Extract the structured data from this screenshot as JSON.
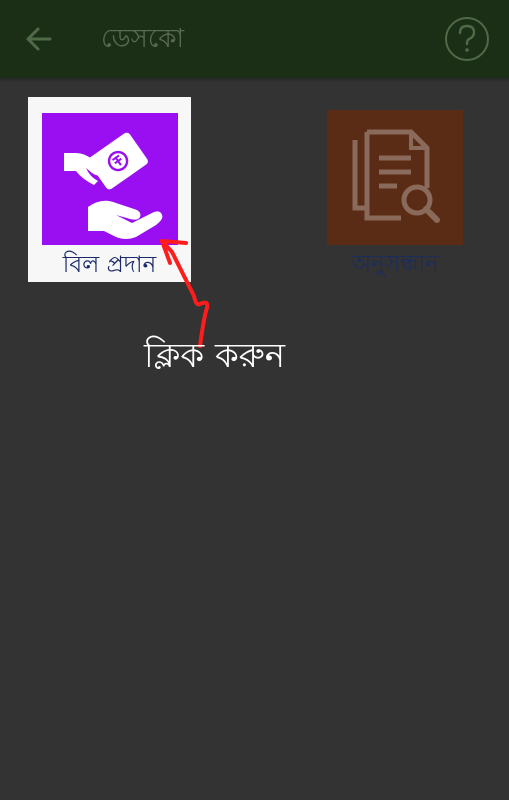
{
  "header": {
    "title": "ডেসকো",
    "back_icon": "arrow-left-icon",
    "help_icon": "question-circle-icon",
    "bar_color": "#1b2e16"
  },
  "menu": {
    "items": [
      {
        "id": "bill-payment",
        "label": "বিল প্রদান",
        "icon": "hand-paying-bill-icon",
        "icon_bg": "#9a0ef2"
      },
      {
        "id": "search",
        "label": "অনুসন্ধান",
        "icon": "document-search-icon",
        "icon_bg": "#5a2c16"
      }
    ]
  },
  "annotation": {
    "text": "ক্লিক করুন",
    "arrow_color": "#ff1c1c"
  }
}
